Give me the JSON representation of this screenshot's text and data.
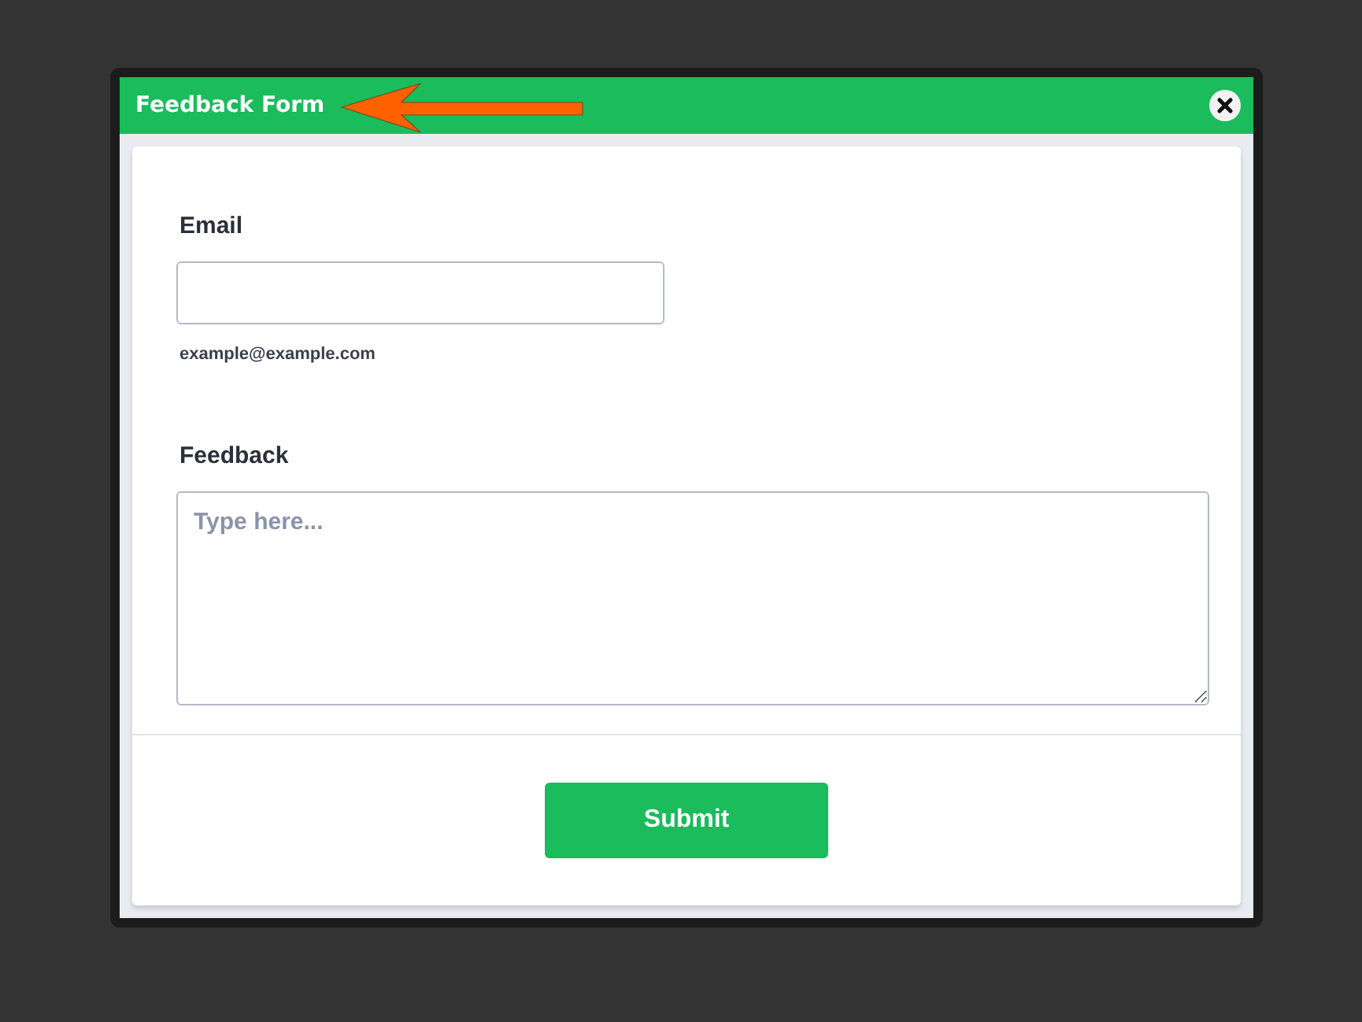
{
  "window": {
    "title": "Feedback Form"
  },
  "form": {
    "fields": [
      {
        "kind": "input",
        "label": "Email",
        "hint": "example@example.com"
      },
      {
        "kind": "textarea",
        "label": "Feedback",
        "placeholder": "Type here..."
      }
    ],
    "submit": "Submit"
  }
}
